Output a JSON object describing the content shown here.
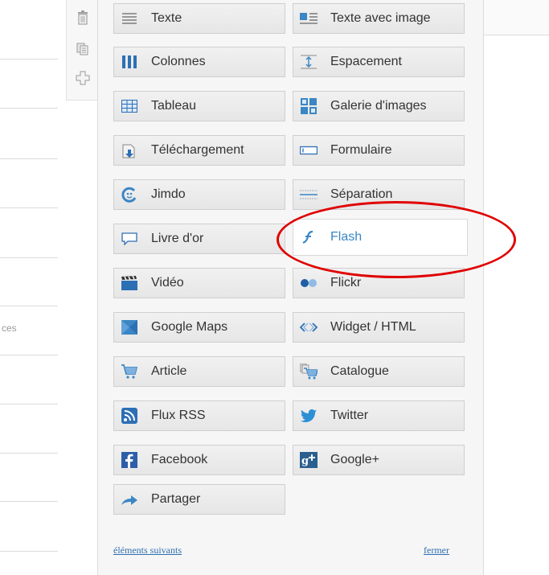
{
  "panel": {
    "items": [
      {
        "label": "Texte",
        "icon": "text-icon"
      },
      {
        "label": "Texte avec image",
        "icon": "text-with-image-icon"
      },
      {
        "label": "Colonnes",
        "icon": "columns-icon"
      },
      {
        "label": "Espacement",
        "icon": "spacing-icon"
      },
      {
        "label": "Tableau",
        "icon": "table-icon"
      },
      {
        "label": "Galerie d'images",
        "icon": "image-gallery-icon"
      },
      {
        "label": "Téléchargement",
        "icon": "download-icon"
      },
      {
        "label": "Formulaire",
        "icon": "form-icon"
      },
      {
        "label": "Jimdo",
        "icon": "jimdo-icon"
      },
      {
        "label": "Séparation",
        "icon": "separator-icon"
      },
      {
        "label": "Livre d'or",
        "icon": "guestbook-icon"
      },
      {
        "label": "Flash",
        "icon": "flash-icon",
        "active": true
      },
      {
        "label": "Vidéo",
        "icon": "video-icon"
      },
      {
        "label": "Flickr",
        "icon": "flickr-icon"
      },
      {
        "label": "Google Maps",
        "icon": "google-maps-icon"
      },
      {
        "label": "Widget / HTML",
        "icon": "widget-html-icon"
      },
      {
        "label": "Article",
        "icon": "cart-icon"
      },
      {
        "label": "Catalogue",
        "icon": "catalogue-icon"
      },
      {
        "label": "Flux RSS",
        "icon": "rss-icon"
      },
      {
        "label": "Twitter",
        "icon": "twitter-icon"
      },
      {
        "label": "Facebook",
        "icon": "facebook-icon"
      },
      {
        "label": "Google+",
        "icon": "google-plus-icon"
      },
      {
        "label": "Partager",
        "icon": "share-icon"
      }
    ],
    "next_link": "éléments suivants",
    "close_link": "fermer"
  },
  "background": {
    "partial_text": "ces"
  },
  "colors": {
    "accent": "#3b86c4",
    "annotation": "#e00000",
    "panel_bg": "#f6f6f6"
  }
}
